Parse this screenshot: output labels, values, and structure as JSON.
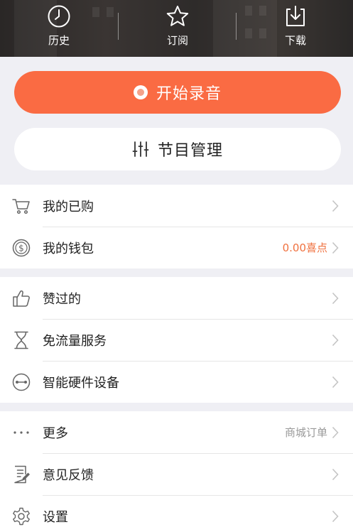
{
  "topbar": {
    "items": [
      {
        "label": "历史",
        "icon": "clock-icon"
      },
      {
        "label": "订阅",
        "icon": "star-icon"
      },
      {
        "label": "下载",
        "icon": "download-icon"
      }
    ]
  },
  "actions": {
    "record_label": "开始录音",
    "programs_label": "节目管理"
  },
  "menu": {
    "group1": [
      {
        "label": "我的已购",
        "icon": "cart-icon"
      },
      {
        "label": "我的钱包",
        "icon": "coin-icon",
        "value": "0.00喜点"
      }
    ],
    "group2": [
      {
        "label": "赞过的",
        "icon": "thumbs-up-icon"
      },
      {
        "label": "免流量服务",
        "icon": "hourglass-icon"
      },
      {
        "label": "智能硬件设备",
        "icon": "device-icon"
      }
    ],
    "group3": [
      {
        "label": "更多",
        "icon": "more-dots-icon",
        "value": "商城订单"
      },
      {
        "label": "意见反馈",
        "icon": "feedback-icon"
      },
      {
        "label": "设置",
        "icon": "gear-icon"
      }
    ]
  },
  "colors": {
    "accent": "#fa6b43",
    "value_orange": "#f0713f",
    "value_gray": "#999999",
    "background": "#efeff4"
  }
}
